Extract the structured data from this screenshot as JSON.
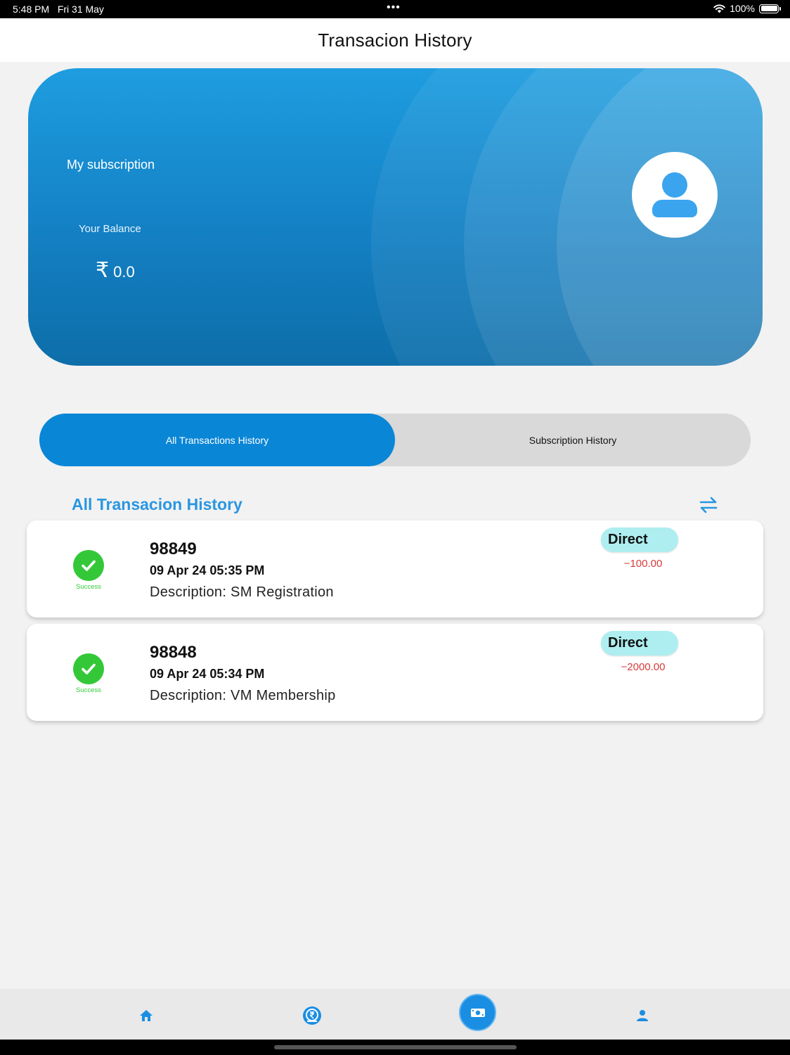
{
  "status_bar": {
    "time": "5:48 PM",
    "date": "Fri 31 May",
    "dots": "•••",
    "battery": "100%"
  },
  "header": {
    "title": "Transacion History"
  },
  "balance_card": {
    "subscription_label": "My subscription",
    "balance_label": "Your Balance",
    "currency_symbol": "₹",
    "balance_value": "0.0"
  },
  "tabs": {
    "all_label": "All Transactions History",
    "subscription_label": "Subscription History",
    "active": "all"
  },
  "section": {
    "title": "All Transacion History"
  },
  "transactions": [
    {
      "status": "Success",
      "id": "98849",
      "datetime": "09 Apr 24 05:35 PM",
      "description": "Description: SM Registration",
      "type": "Direct",
      "amount": "−100.00"
    },
    {
      "status": "Success",
      "id": "98848",
      "datetime": "09 Apr 24 05:34 PM",
      "description": "Description: VM Membership",
      "type": "Direct",
      "amount": "−2000.00"
    }
  ],
  "bottom_nav": {
    "items": [
      "home-icon",
      "rupee-wallet-icon",
      "money-icon",
      "user-icon"
    ],
    "active": "money-icon"
  },
  "colors": {
    "accent": "#0a86d6",
    "heading_blue": "#2a96e1",
    "success": "#34c838",
    "debit": "#d83a3a",
    "badge": "#aeeef0"
  }
}
